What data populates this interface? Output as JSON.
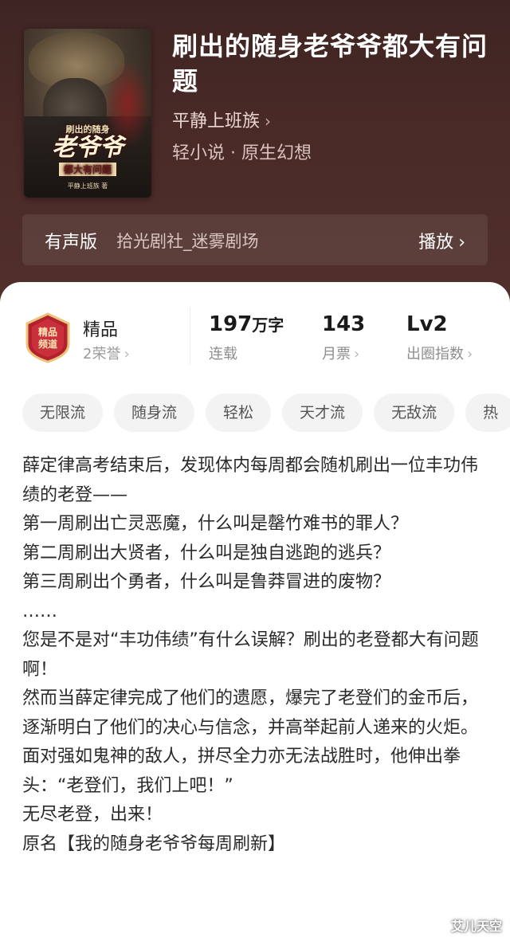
{
  "book": {
    "title": "刷出的随身老爷爷都大有问题",
    "author": "平静上班族",
    "author_chevron": "›",
    "genre": "轻小说 · 原生幻想",
    "cover": {
      "small_top": "刷出的随身",
      "big": "老爷爷",
      "small_bottom": "都大有问题",
      "author": "平静上班族 著"
    }
  },
  "audio": {
    "label": "有声版",
    "source": "拾光剧社_迷雾剧场",
    "play_label": "播放",
    "chevron": "›"
  },
  "stats": {
    "premium": {
      "badge_line1": "精品",
      "badge_line2": "频道",
      "label": "精品",
      "sub": "2荣誉",
      "chevron": "›"
    },
    "words": {
      "num": "197",
      "unit": "万字",
      "label": "连载"
    },
    "tickets": {
      "num": "143",
      "label": "月票",
      "chevron": "›"
    },
    "level": {
      "num": "Lv2",
      "label": "出圈指数",
      "chevron": "›"
    }
  },
  "tags": [
    "无限流",
    "随身流",
    "轻松",
    "天才流",
    "无敌流",
    "热"
  ],
  "intro": [
    "薛定律高考结束后，发现体内每周都会随机刷出一位丰功伟绩的老登——",
    "第一周刷出亡灵恶魔，什么叫是罄竹难书的罪人？",
    "第二周刷出大贤者，什么叫是独自逃跑的逃兵？",
    "第三周刷出个勇者，什么叫是鲁莽冒进的废物？",
    "……",
    "您是不是对“丰功伟绩”有什么误解？刷出的老登都大有问题啊！",
    "然而当薛定律完成了他们的遗愿，爆完了老登们的金币后，逐渐明白了他们的决心与信念，并高举起前人递来的火炬。",
    "面对强如鬼神的敌人，拼尽全力亦无法战胜时，他伸出拳头：“老登们，我们上吧！”",
    "无尽老登，出来！",
    "原名【我的随身老爷爷每周刷新】"
  ],
  "watermark": "艾儿天空",
  "colors": {
    "header_bg": "#4a2a27",
    "badge_red": "#b3212f",
    "badge_gold": "#e9c47a"
  }
}
